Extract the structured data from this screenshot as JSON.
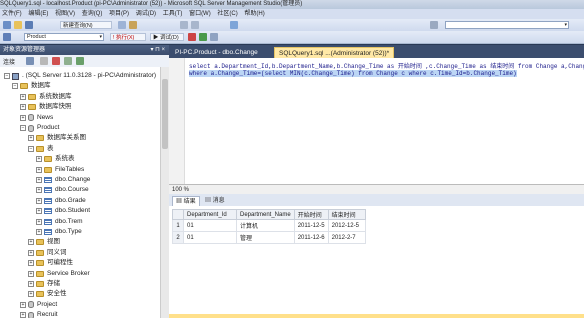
{
  "window": {
    "title": "SQLQuery1.sql - localhost.Product (pi-PC\\Administrator (52)) - Microsoft SQL Server Management Studio(管理员)"
  },
  "menu": [
    "文件(F)",
    "编辑(E)",
    "视图(V)",
    "查询(Q)",
    "项目(P)",
    "调试(D)",
    "工具(T)",
    "窗口(W)",
    "社区(C)",
    "帮助(H)"
  ],
  "toolbar": {
    "new_query_label": "新建查询(N)",
    "database_selected": "Product",
    "execute_label": "! 执行(X)",
    "debug_label": "▶ 调试(D)"
  },
  "object_explorer": {
    "title": "对象资源管理器",
    "header_controls": "▾ ⊓ ×",
    "connect_label": "连接",
    "tree": [
      {
        "label": ". (SQL Server 11.0.3128 - pi-PC\\Administrator)",
        "level": 0,
        "expander": "−",
        "icon": "server-icon"
      },
      {
        "label": "数据库",
        "level": 1,
        "expander": "−",
        "icon": "folder-icon"
      },
      {
        "label": "系统数据库",
        "level": 2,
        "expander": "+",
        "icon": "folder-icon"
      },
      {
        "label": "数据库快照",
        "level": 2,
        "expander": "+",
        "icon": "folder-icon"
      },
      {
        "label": "News",
        "level": 2,
        "expander": "+",
        "icon": "database-icon"
      },
      {
        "label": "Product",
        "level": 2,
        "expander": "−",
        "icon": "database-icon"
      },
      {
        "label": "数据库关系图",
        "level": 3,
        "expander": "+",
        "icon": "folder-icon"
      },
      {
        "label": "表",
        "level": 3,
        "expander": "−",
        "icon": "folder-icon"
      },
      {
        "label": "系统表",
        "level": 4,
        "expander": "+",
        "icon": "folder-icon"
      },
      {
        "label": "FileTables",
        "level": 4,
        "expander": "+",
        "icon": "folder-icon"
      },
      {
        "label": "dbo.Change",
        "level": 4,
        "expander": "+",
        "icon": "table-icon"
      },
      {
        "label": "dbo.Course",
        "level": 4,
        "expander": "+",
        "icon": "table-icon"
      },
      {
        "label": "dbo.Grade",
        "level": 4,
        "expander": "+",
        "icon": "table-icon"
      },
      {
        "label": "dbo.Student",
        "level": 4,
        "expander": "+",
        "icon": "table-icon"
      },
      {
        "label": "dbo.Trem",
        "level": 4,
        "expander": "+",
        "icon": "table-icon"
      },
      {
        "label": "dbo.Type",
        "level": 4,
        "expander": "+",
        "icon": "table-icon"
      },
      {
        "label": "视图",
        "level": 3,
        "expander": "+",
        "icon": "folder-icon"
      },
      {
        "label": "同义词",
        "level": 3,
        "expander": "+",
        "icon": "folder-icon"
      },
      {
        "label": "可编程性",
        "level": 3,
        "expander": "+",
        "icon": "folder-icon"
      },
      {
        "label": "Service Broker",
        "level": 3,
        "expander": "+",
        "icon": "folder-icon"
      },
      {
        "label": "存储",
        "level": 3,
        "expander": "+",
        "icon": "folder-icon"
      },
      {
        "label": "安全性",
        "level": 3,
        "expander": "+",
        "icon": "folder-icon"
      },
      {
        "label": "Project",
        "level": 2,
        "expander": "+",
        "icon": "database-icon"
      },
      {
        "label": "Recruit",
        "level": 2,
        "expander": "+",
        "icon": "database-icon"
      }
    ]
  },
  "editor": {
    "tabs": [
      {
        "label": "PI-PC.Product - dbo.Change",
        "active": false
      },
      {
        "label": "SQLQuery1.sql ...(Administrator (52))*",
        "active": true
      }
    ],
    "lines": [
      "select a.Department_Id,b.Department_Name,b.Change_Time as 开始时间 ,c.Change_Time as 结束时间 from Change a,Change b,",
      "where a.Change_Time=(select MIN(c.Change_Time) from Change c where c.Time_Id=b.Change_Time)"
    ],
    "zoom": "100 %"
  },
  "results": {
    "tabs": [
      {
        "label": "结果",
        "active": true
      },
      {
        "label": "消息",
        "active": false
      }
    ],
    "columns": [
      "Department_Id",
      "Department_Name",
      "开始时间",
      "结束时间"
    ],
    "rows": [
      {
        "n": "1",
        "cells": [
          "01",
          "计算机",
          "2011-12-5",
          "2012-12-5"
        ]
      },
      {
        "n": "2",
        "cells": [
          "01",
          "管理",
          "2011-12-6",
          "2012-2-7"
        ]
      }
    ]
  },
  "colors": {
    "chrome_dark": "#293955",
    "active_tab": "#ffe8a6",
    "selection": "#bcd6f5"
  }
}
